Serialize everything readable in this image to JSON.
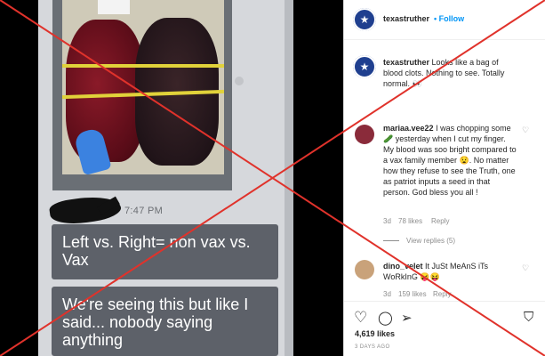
{
  "media": {
    "time": "7:47 PM",
    "bubble1": "Left vs. Right= non vax vs. Vax",
    "bubble2": "We're seeing this but like I said... nobody saying anything"
  },
  "post": {
    "username": "texastruther",
    "follow_sep": "•",
    "follow_label": "Follow",
    "caption_user": "texastruther",
    "caption_text": "Looks like a bag of blood clots. Nothing to see. Totally normal. 👀",
    "comments": [
      {
        "user": "mariaa.vee22",
        "text": "I was chopping some 🥒 yesterday when I cut my finger. My blood was soo bright compared to a vax family member 😧. No matter how they refuse to see the Truth, one as patriot inputs a seed in that person. God bless you all !",
        "age": "3d",
        "likes": "78 likes",
        "reply": "Reply"
      },
      {
        "user": "dino_velet",
        "text": "It JuSt MeAnS iTs WoRkInG 😝😝",
        "age": "3d",
        "likes": "159 likes",
        "reply": "Reply"
      }
    ],
    "view_replies": "View replies (5)",
    "likes_count": "4,619 likes",
    "time_ago": "3 DAYS AGO"
  },
  "icons": {
    "heart": "♡",
    "comment": "◯",
    "share": "➢",
    "save": "⛉",
    "star": "★"
  },
  "colors": {
    "overlay_red": "#e0322b",
    "follow_blue": "#0095f6",
    "bubble_gray": "#5d6169"
  }
}
